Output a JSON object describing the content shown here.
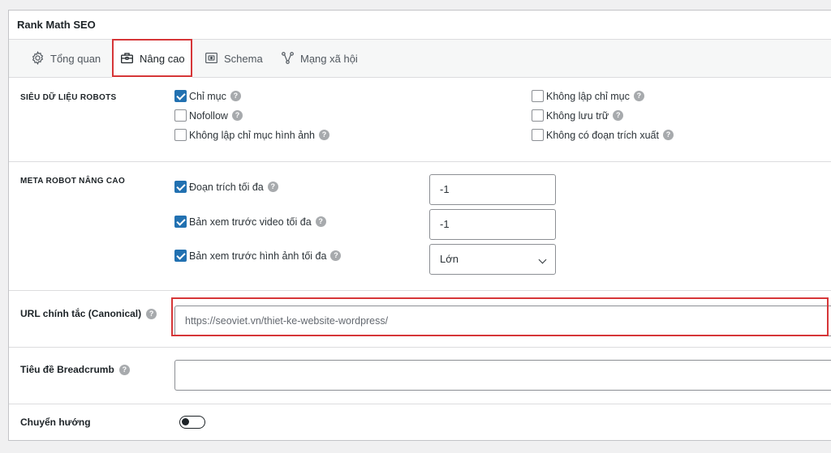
{
  "panel": {
    "title": "Rank Math SEO"
  },
  "tabs": [
    {
      "label": "Tổng quan",
      "icon": "gear-icon",
      "active": false
    },
    {
      "label": "Nâng cao",
      "icon": "briefcase-icon",
      "active": true
    },
    {
      "label": "Schema",
      "icon": "schema-icon",
      "active": false
    },
    {
      "label": "Mạng xã hội",
      "icon": "share-nodes-icon",
      "active": false
    }
  ],
  "robots": {
    "label": "SIÊU DỮ LIỆU ROBOTS",
    "options": [
      {
        "label": "Chỉ mục",
        "checked": true
      },
      {
        "label": "Nofollow",
        "checked": false
      },
      {
        "label": "Không lập chỉ mục hình ảnh",
        "checked": false
      },
      {
        "label": "Không lập chỉ mục",
        "checked": false
      },
      {
        "label": "Không lưu trữ",
        "checked": false
      },
      {
        "label": "Không có đoạn trích xuất",
        "checked": false
      }
    ]
  },
  "advanced": {
    "label": "META ROBOT NÂNG CAO",
    "items": [
      {
        "label": "Đoạn trích tối đa",
        "checked": true,
        "value": "-1"
      },
      {
        "label": "Bản xem trước video tối đa",
        "checked": true,
        "value": "-1"
      },
      {
        "label": "Bản xem trước hình ảnh tối đa",
        "checked": true,
        "value": "Lớn"
      }
    ]
  },
  "canonical": {
    "label": "URL chính tắc (Canonical)",
    "placeholder": "https://seoviet.vn/thiet-ke-website-wordpress/"
  },
  "breadcrumb": {
    "label": "Tiêu đề Breadcrumb",
    "value": ""
  },
  "redirect": {
    "label": "Chuyển hướng",
    "enabled": false
  },
  "colors": {
    "accent": "#2271b1",
    "highlight": "#d63638",
    "border": "#dcdcde"
  }
}
